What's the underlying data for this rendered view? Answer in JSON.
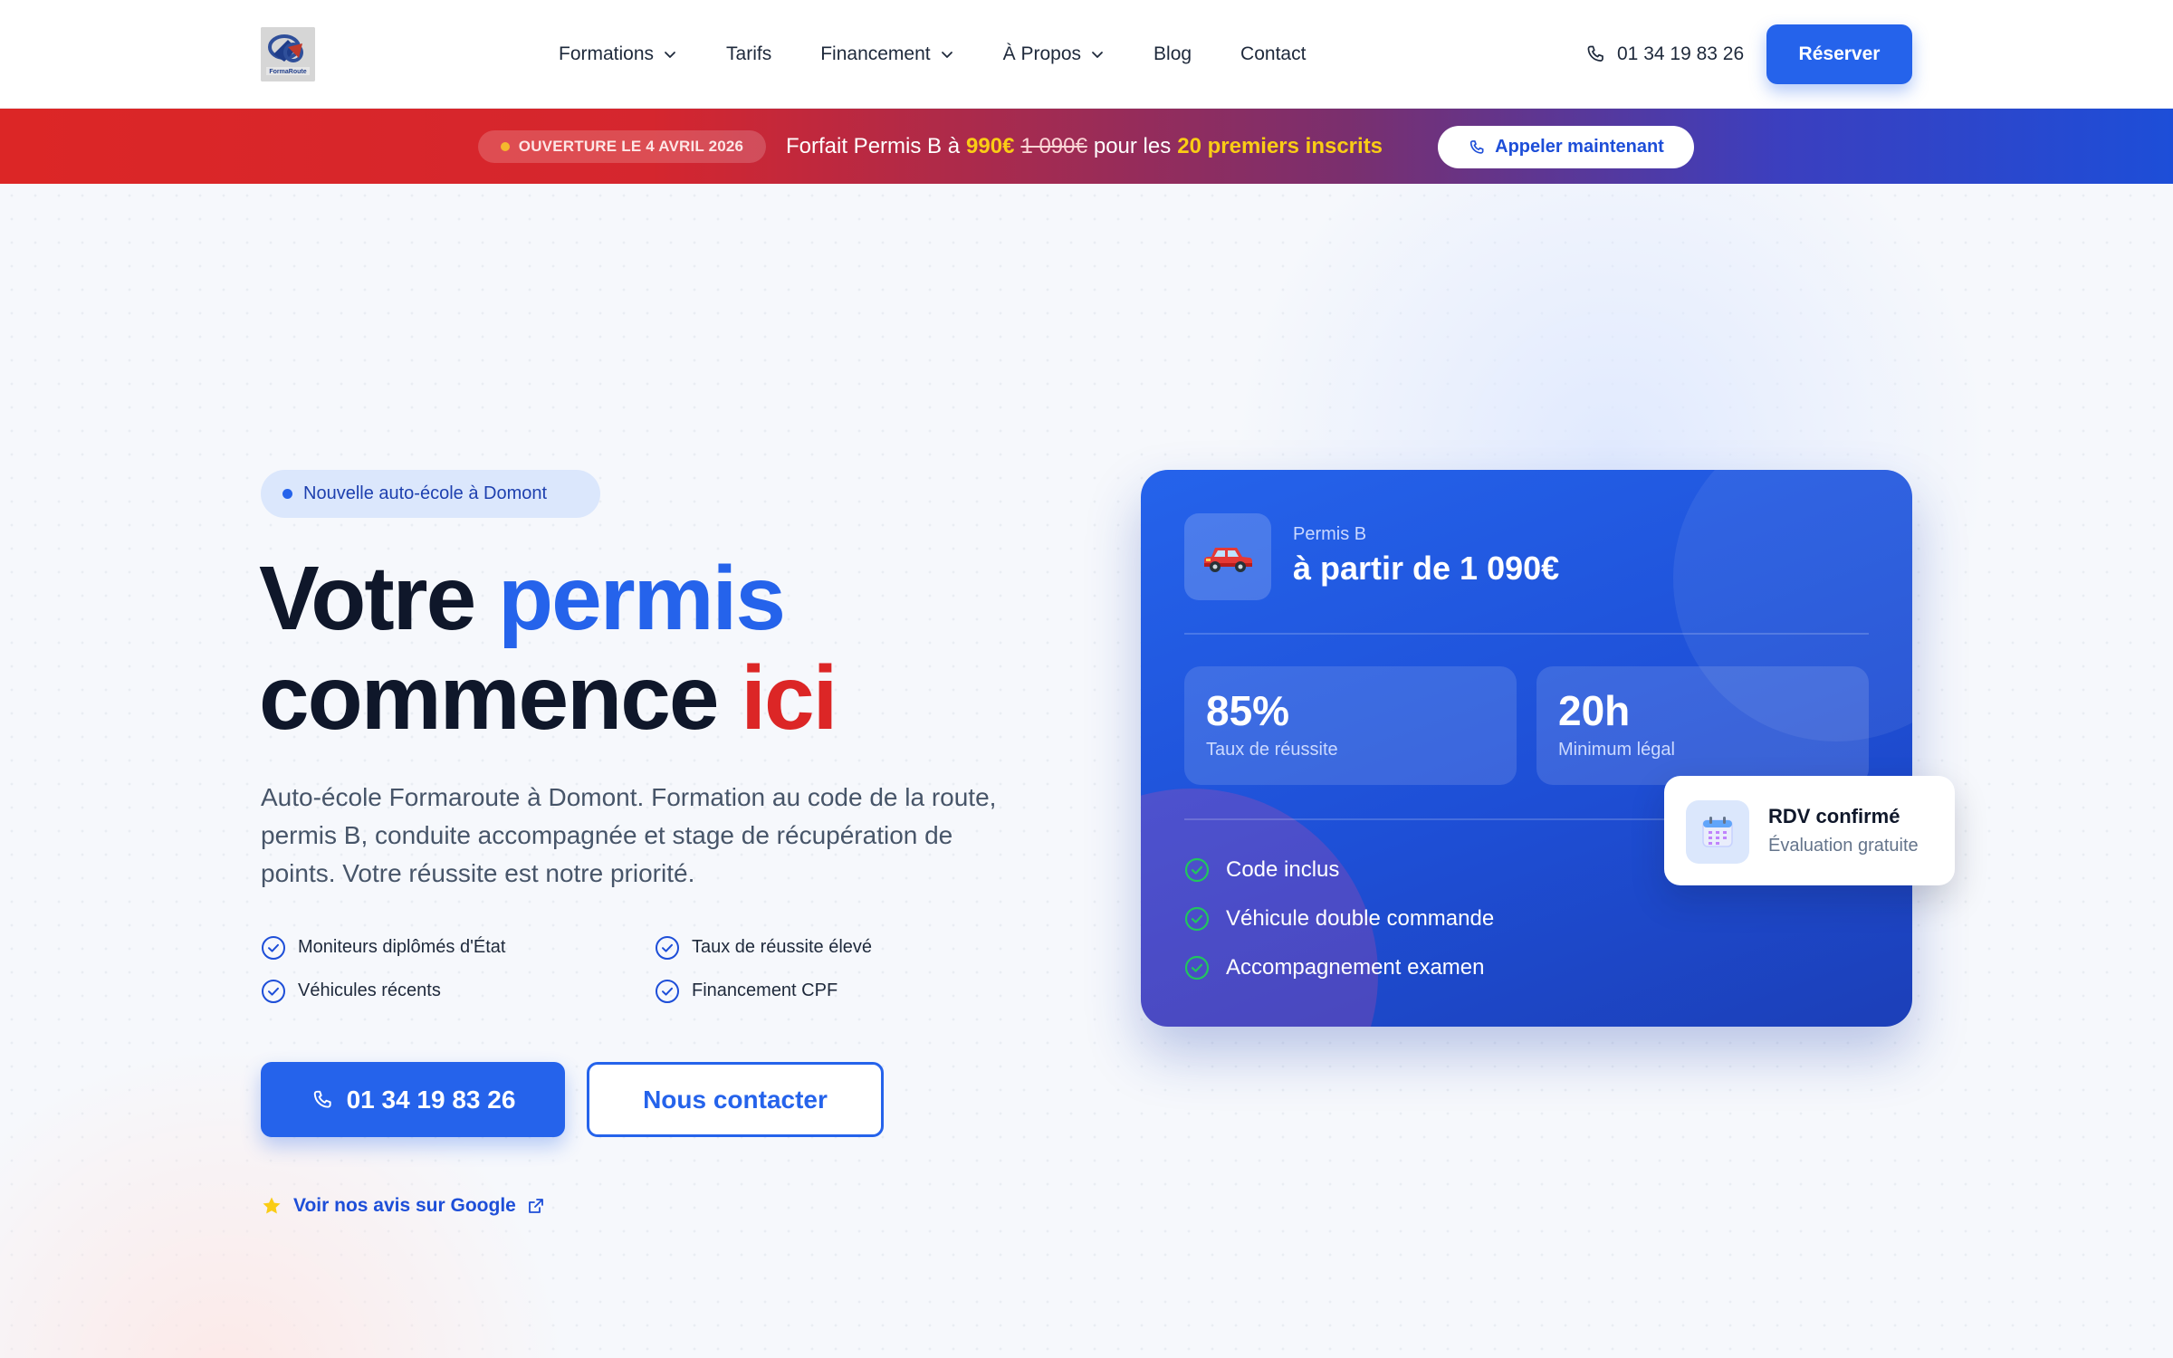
{
  "header": {
    "logo_alt": "FormaRoute",
    "nav": [
      {
        "label": "Formations",
        "icon": "chevron-down-icon"
      },
      {
        "label": "Tarifs"
      },
      {
        "label": "Financement",
        "icon": "chevron-down-icon"
      },
      {
        "label": "À Propos",
        "icon": "chevron-down-icon"
      },
      {
        "label": "Blog"
      },
      {
        "label": "Contact"
      }
    ],
    "phone": "01 34 19 83 26",
    "reserve_label": "Réserver"
  },
  "promo": {
    "badge": "OUVERTURE LE 4 AVRIL 2026",
    "text_prefix": "Forfait Permis B à",
    "new_price": "990€",
    "old_price": "1 090€",
    "text_middle": "pour les",
    "highlight": "20 premiers inscrits",
    "call_label": "Appeler maintenant"
  },
  "hero": {
    "pill": "Nouvelle auto-école à Domont",
    "title_part1": "Votre",
    "title_part2": "permis",
    "title_part3": "commence",
    "title_part4": "ici",
    "description": "Auto-école Formaroute à Domont. Formation au code de la route, permis B, conduite accompagnée et stage de récupération de points. Votre réussite est notre priorité.",
    "features": [
      "Moniteurs diplômés d'État",
      "Taux de réussite élevé",
      "Véhicules récents",
      "Financement CPF"
    ],
    "phone_button": "01 34 19 83 26",
    "contact_button": "Nous contacter",
    "google_link": "Voir nos avis sur Google"
  },
  "card": {
    "subtitle": "Permis B",
    "price": "à partir de 1 090€",
    "stats": [
      {
        "value": "85%",
        "label": "Taux de réussite"
      },
      {
        "value": "20h",
        "label": "Minimum légal"
      }
    ],
    "items": [
      "Code inclus",
      "Véhicule double commande",
      "Accompagnement examen"
    ]
  },
  "rdv": {
    "title": "RDV confirmé",
    "subtitle": "Évaluation gratuite"
  },
  "colors": {
    "primary": "#2563eb",
    "accent_red": "#dc2626",
    "promo_yellow": "#facc15",
    "success_green": "#22c55e"
  }
}
